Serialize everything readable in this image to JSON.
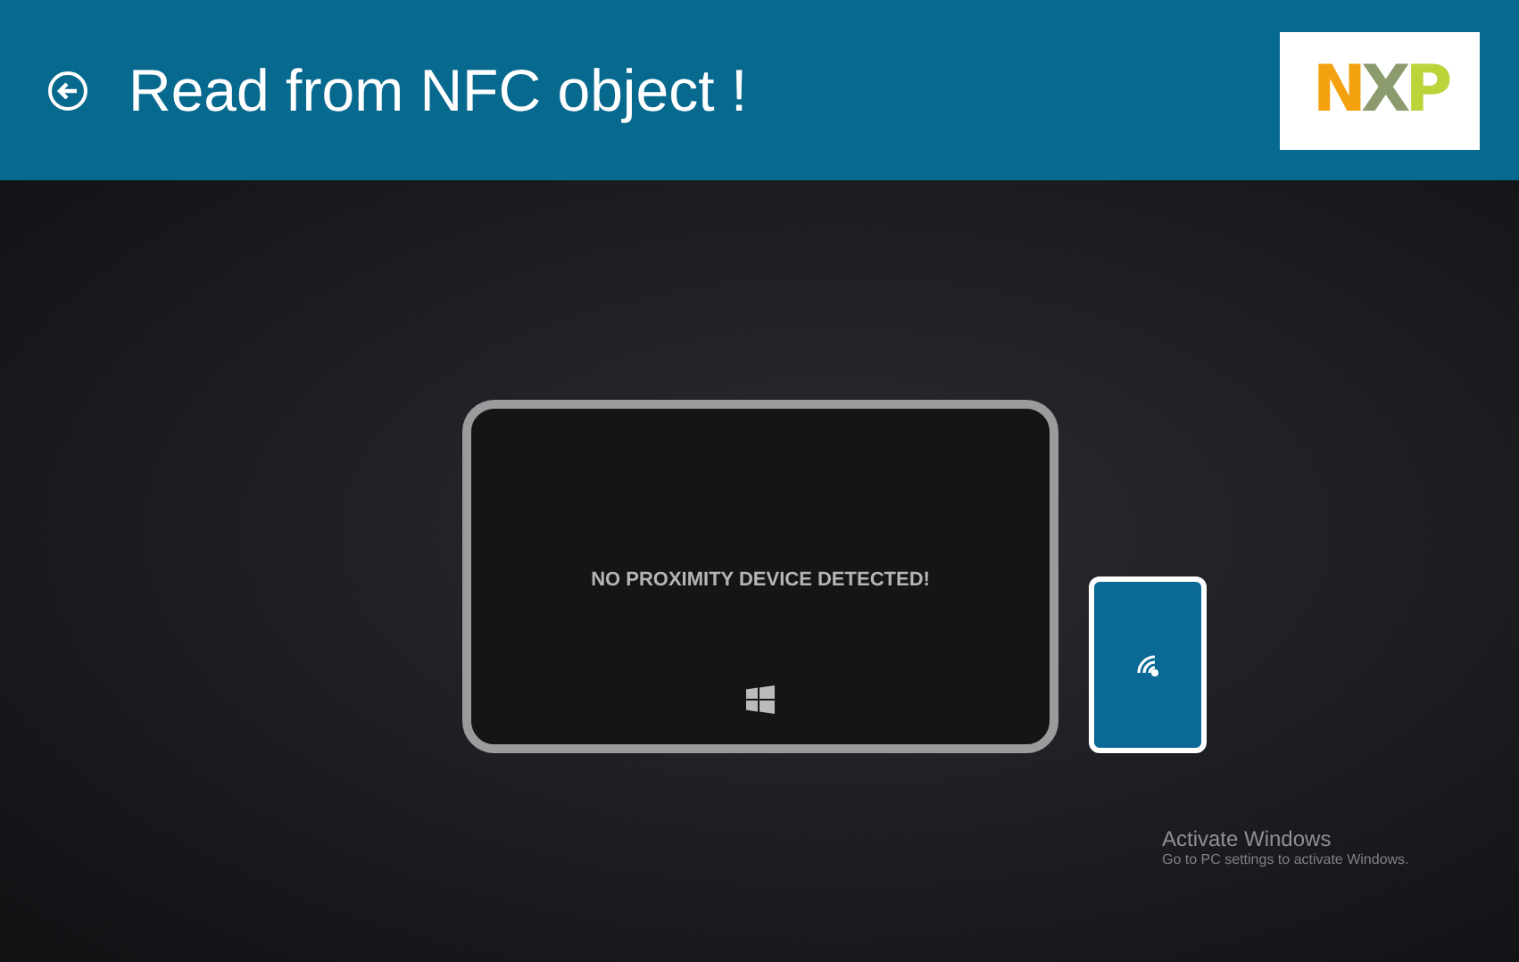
{
  "header": {
    "title": "Read from NFC object !",
    "logo": "NXP"
  },
  "tablet": {
    "message": "NO PROXIMITY DEVICE DETECTED!"
  },
  "activation_notice": {
    "title": "Activate Windows",
    "subtitle": "Go to PC settings to activate Windows."
  }
}
